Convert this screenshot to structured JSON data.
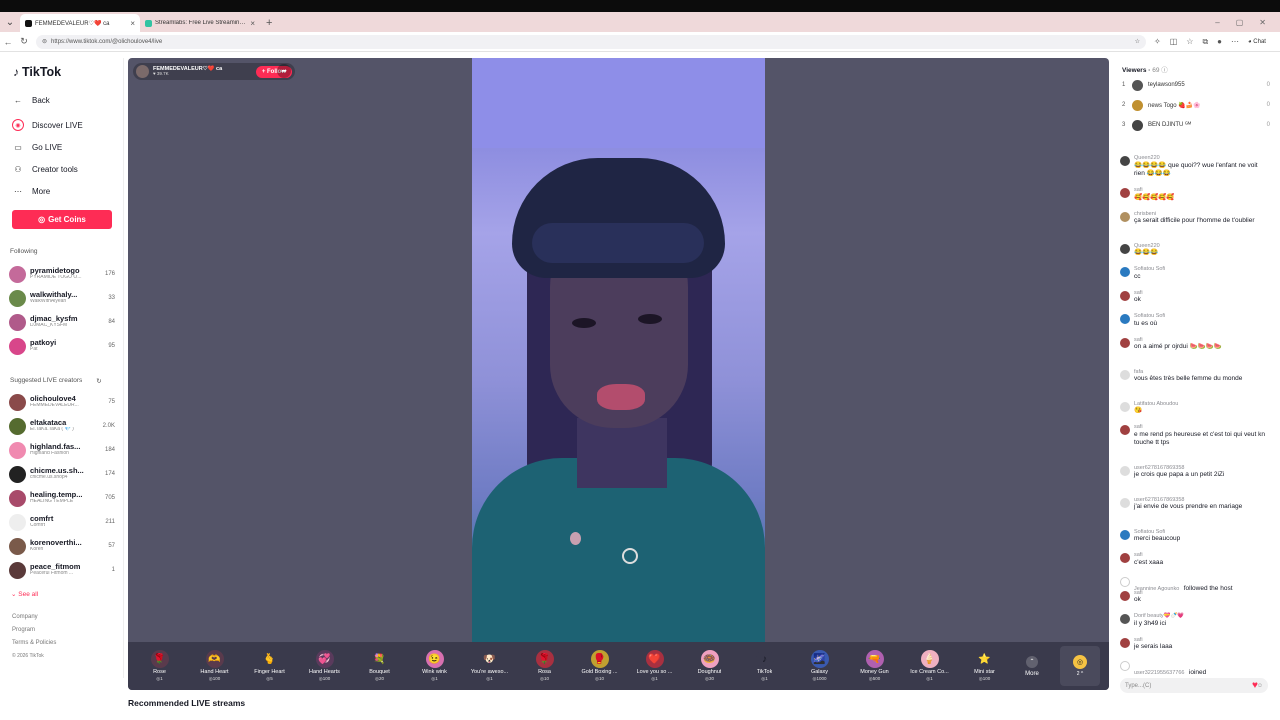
{
  "browser": {
    "tabs": [
      {
        "title": "FEMMEDEVALEUR♡❤️ ca",
        "active": true,
        "color": "#111111"
      },
      {
        "title": "Streamlabs: Free Live Streaming &",
        "active": false,
        "color": "#31c3a2"
      }
    ],
    "url": "https://www.tiktok.com/@olichoulove4/live",
    "chat_label": "Chat"
  },
  "sidebar": {
    "logo": "TikTok",
    "back": "Back",
    "nav": [
      "Discover LIVE",
      "Go LIVE",
      "Creator tools",
      "More"
    ],
    "get_coins": "Get Coins",
    "following_header": "Following",
    "following": [
      {
        "name": "pyramidetogo",
        "sub": "PYRAMIDE TOGO O...",
        "count": "176",
        "color": "#c46a9a"
      },
      {
        "name": "walkwithaly...",
        "sub": "WalkWithAlyeah",
        "count": "33",
        "color": "#6a8a4a"
      },
      {
        "name": "djmac_kysfm",
        "sub": "DJMAC_KYSFM",
        "count": "84",
        "color": "#b05a8a"
      },
      {
        "name": "patkoyi",
        "sub": "Pat",
        "count": "95",
        "color": "#d8468a"
      }
    ],
    "suggested_header": "Suggested LIVE creators",
    "suggested": [
      {
        "name": "olichoulove4",
        "sub": "FEMMEDEVALEUR...",
        "count": "75",
        "color": "#8a4a4a"
      },
      {
        "name": "eltakataca",
        "sub": "El.TaKa.TaKa ( 💎 )",
        "count": "2.0K",
        "color": "#556b2f"
      },
      {
        "name": "highland.fas...",
        "sub": "Highland Fashion",
        "count": "184",
        "color": "#f08ab0"
      },
      {
        "name": "chicme.us.sh...",
        "sub": "chicme.us.shop4",
        "count": "174",
        "color": "#222222"
      },
      {
        "name": "healing.temp...",
        "sub": "HEALING TEMPLE",
        "count": "705",
        "color": "#a84a6a"
      },
      {
        "name": "comfrt",
        "sub": "Comfrt",
        "count": "211",
        "color": "#eeeeee"
      },
      {
        "name": "korenoverthi...",
        "sub": "Koren",
        "count": "57",
        "color": "#7a5a4a"
      },
      {
        "name": "peace_fitmom",
        "sub": "Peaceful Fitmom ...",
        "count": "1",
        "color": "#5a3a3a"
      }
    ],
    "see_all": "See all",
    "footer": [
      "Company",
      "Program",
      "Terms & Policies",
      "© 2026 TikTok"
    ]
  },
  "stream": {
    "host_name": "FEMMEDEVALEUR♡❤️ ca",
    "host_likes": "♥ 39.7K",
    "follow": "+ Follow"
  },
  "gifts": [
    {
      "name": "Rose",
      "price": "1",
      "icon": "🌹",
      "bg": "#5a3a4c"
    },
    {
      "name": "Hand Heart",
      "price": "100",
      "icon": "🫶",
      "bg": "#5a3a4c"
    },
    {
      "name": "Finger Heart",
      "price": "5",
      "icon": "🫰",
      "bg": "#3a3a4c"
    },
    {
      "name": "Hand Hearts",
      "price": "100",
      "icon": "💞",
      "bg": "#5a3a5c"
    },
    {
      "name": "Bouquet",
      "price": "20",
      "icon": "💐",
      "bg": "#3a3a4c"
    },
    {
      "name": "Wink wink",
      "price": "1",
      "icon": "😉",
      "bg": "#d870b0"
    },
    {
      "name": "You're aweso...",
      "price": "1",
      "icon": "🐶",
      "bg": "#3a3a4c"
    },
    {
      "name": "Rosa",
      "price": "10",
      "icon": "🌹",
      "bg": "#a83040"
    },
    {
      "name": "Gold Boxing ...",
      "price": "10",
      "icon": "🥊",
      "bg": "#c0a030"
    },
    {
      "name": "Love you so ...",
      "price": "1",
      "icon": "❤️",
      "bg": "#a83040"
    },
    {
      "name": "Doughnut",
      "price": "30",
      "icon": "🍩",
      "bg": "#f0a0c0"
    },
    {
      "name": "TikTok",
      "price": "1",
      "icon": "♪",
      "bg": "#3a3a4c"
    },
    {
      "name": "Galaxy",
      "price": "1000",
      "icon": "🌌",
      "bg": "#3a5ab0"
    },
    {
      "name": "Money Gun",
      "price": "500",
      "icon": "🔫",
      "bg": "#b060b0"
    },
    {
      "name": "Ice Cream Co...",
      "price": "1",
      "icon": "🍦",
      "bg": "#f0b0c0"
    },
    {
      "name": "Mini star",
      "price": "100",
      "icon": "⭐",
      "bg": "#3a3a4c"
    }
  ],
  "gift_more": "More",
  "coin_balance": "2",
  "recommended": "Recommended LIVE streams",
  "viewers": {
    "label": "Viewers",
    "count": "69",
    "top": [
      {
        "rank": "1",
        "name": "teylawson955",
        "score": "0",
        "color": "#555555"
      },
      {
        "rank": "2",
        "name": "news Togo 🍓🍰🌸",
        "score": "0",
        "color": "#c09030"
      },
      {
        "rank": "3",
        "name": "BEN DJINTU ᴳᴹ",
        "score": "0",
        "color": "#444444"
      }
    ]
  },
  "chat": [
    {
      "user": "chrisbeni",
      "text": "😂😂😂",
      "color": "#b09060"
    },
    {
      "user": "Queen220",
      "text": "😂😂😂😂 que quoi?? wue l'enfant ne voit rien 😂😂😂",
      "color": "#444444"
    },
    {
      "user": "safi",
      "text": "🥰🥰🥰🥰🥰",
      "color": "#a04040"
    },
    {
      "user": "chrisbeni",
      "text": "ça serait difficile pour l'homme de t'oublier",
      "color": "#b09060"
    },
    {
      "user": "Queen220",
      "text": "😂😂😂",
      "color": "#444444"
    },
    {
      "user": "Sofiatou Sofi",
      "text": "cc",
      "color": "#2a7ac0"
    },
    {
      "user": "safi",
      "text": "ok",
      "color": "#a04040"
    },
    {
      "user": "Sofiatou Sofi",
      "text": "tu es où",
      "color": "#2a7ac0"
    },
    {
      "user": "safi",
      "text": "on a aimé pr ojrdui 🍉🍉🍉🍉",
      "color": "#a04040"
    },
    {
      "user": "fafa",
      "text": "vous êtes très belle femme du monde",
      "color": "#dddddd"
    },
    {
      "user": "Latifatou Aboudou",
      "text": "😘",
      "color": "#dddddd"
    },
    {
      "user": "safi",
      "text": "e me rend ps heureuse et c'est toi qui veut kn touche tt tps",
      "color": "#a04040"
    },
    {
      "user": "user6278167869358",
      "text": "je crois que papa a un petit 2iZi",
      "color": "#dddddd"
    },
    {
      "user": "user6278167869358",
      "text": "j'ai envie de vous prendre en mariage",
      "color": "#dddddd"
    },
    {
      "user": "Sofiatou Sofi",
      "text": "merci beaucoup",
      "color": "#2a7ac0"
    },
    {
      "user": "safi",
      "text": "c'est xaaa",
      "color": "#a04040"
    },
    {
      "user": "Jeannine Agounko",
      "text": "followed the host",
      "color": "#ffffff"
    },
    {
      "user": "safi",
      "text": "ok",
      "color": "#a04040"
    },
    {
      "user": "Dorif beauty💝🍼💗",
      "text": "il y 3h49 ici",
      "color": "#555555"
    },
    {
      "user": "safi",
      "text": "je serais laaa",
      "color": "#a04040"
    },
    {
      "user": "user3221955637766",
      "text": "joined",
      "color": "#ffffff"
    }
  ],
  "chat_input_placeholder": "Type...(C)"
}
